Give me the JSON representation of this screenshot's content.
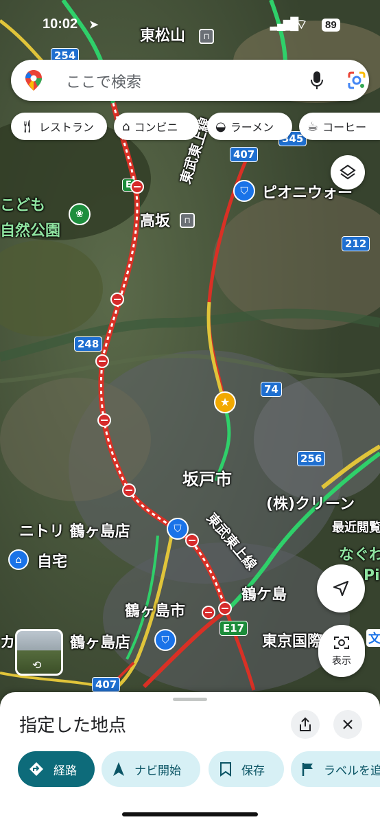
{
  "status_bar": {
    "time": "10:02",
    "battery": "89"
  },
  "search": {
    "placeholder": "ここで検索"
  },
  "chips": [
    {
      "label": "レストラン",
      "icon": "restaurant-icon"
    },
    {
      "label": "コンビニ",
      "icon": "convenience-store-icon"
    },
    {
      "label": "ラーメン",
      "icon": "ramen-icon"
    },
    {
      "label": "コーヒー",
      "icon": "coffee-icon"
    }
  ],
  "map": {
    "labels": {
      "higashimatsuyama": "東松山",
      "takasaka": "高坂",
      "tobu_line_1": "東武東上線",
      "tobu_line_2": "東武東上線",
      "pionwalk": "ピオニウォー",
      "kodomo_park_1": "こども",
      "kodomo_park_2": "自然公園",
      "sakado": "坂戸市",
      "nitori": "ニトリ 鶴ヶ島店",
      "home": "自宅",
      "kureen": "(株)クリーン",
      "recent": "最近閲覧",
      "tsurugashima_station": "鶴ケ島",
      "tsurugashima_city": "鶴ヶ島市",
      "tsurugashima_store": "鶴ヶ島店",
      "kain": "カイ",
      "tokyo_kokusai": "東京国際",
      "nagure": "なぐわ",
      "pi": "Pi",
      "bun": "文"
    },
    "shields": {
      "r254": "254",
      "r407_top": "407",
      "r345": "345",
      "r212": "212",
      "r248": "248",
      "r74": "74",
      "r256": "256",
      "e17": "E17",
      "r407_bottom": "407",
      "e_top": "E"
    }
  },
  "controls": {
    "show_label": "表示"
  },
  "sheet": {
    "title": "指定した地点",
    "actions": [
      {
        "label": "経路"
      },
      {
        "label": "ナビ開始"
      },
      {
        "label": "保存"
      },
      {
        "label": "ラベルを追"
      }
    ]
  }
}
